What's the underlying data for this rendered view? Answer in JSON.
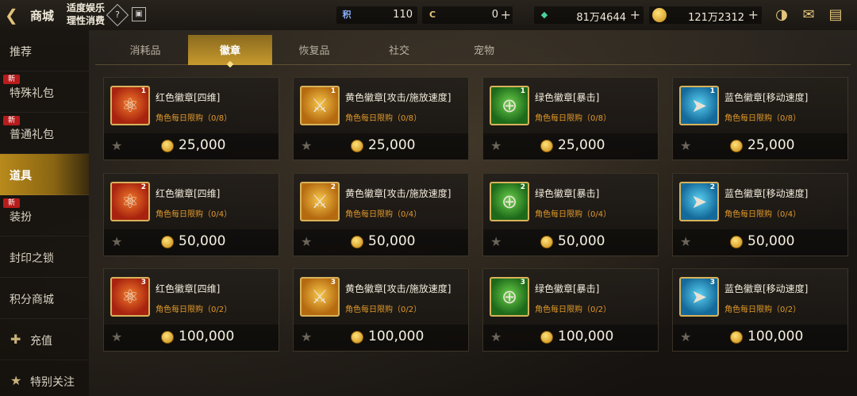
{
  "header": {
    "back_icon": "back-arrow-icon",
    "title": "商城",
    "notice_line1": "适度娱乐",
    "notice_line2": "理性消费",
    "help_label": "?",
    "calendar_label": "📅"
  },
  "currencies": [
    {
      "icon": "积",
      "value": "110",
      "has_plus": false
    },
    {
      "icon": "C",
      "value": "0",
      "has_plus": true
    },
    {
      "icon": "◆",
      "value": "81万4644",
      "has_plus": true
    },
    {
      "icon": "●",
      "value": "121万2312",
      "has_plus": true
    }
  ],
  "top_icons": [
    "pot-icon",
    "mail-icon",
    "chat-icon"
  ],
  "sidebar": {
    "items": [
      {
        "label": "推荐",
        "new": false
      },
      {
        "label": "特殊礼包",
        "new": true
      },
      {
        "label": "普通礼包",
        "new": true
      },
      {
        "label": "道具",
        "new": false,
        "active": true
      },
      {
        "label": "装扮",
        "new": true
      },
      {
        "label": "封印之锁",
        "new": false
      },
      {
        "label": "积分商城",
        "new": false
      },
      {
        "label": "充值",
        "new": false,
        "icon": "recharge-icon"
      },
      {
        "label": "特别关注",
        "new": false,
        "icon": "star-icon"
      }
    ],
    "new_tag": "新"
  },
  "tabs": [
    {
      "label": "消耗品",
      "active": false
    },
    {
      "label": "徽章",
      "active": true
    },
    {
      "label": "恢复品",
      "active": false
    },
    {
      "label": "社交",
      "active": false
    },
    {
      "label": "宠物",
      "active": false
    }
  ],
  "items": [
    {
      "name": "红色徽章[四维]",
      "limit": "角色每日限购（0/8）",
      "price": "25,000",
      "color": "red",
      "level": "1"
    },
    {
      "name": "黄色徽章[攻击/施放速度]",
      "limit": "角色每日限购（0/8）",
      "price": "25,000",
      "color": "yellow",
      "level": "1"
    },
    {
      "name": "绿色徽章[暴击]",
      "limit": "角色每日限购（0/8）",
      "price": "25,000",
      "color": "green",
      "level": "1"
    },
    {
      "name": "蓝色徽章[移动速度]",
      "limit": "角色每日限购（0/8）",
      "price": "25,000",
      "color": "blue",
      "level": "1"
    },
    {
      "name": "红色徽章[四维]",
      "limit": "角色每日限购（0/4）",
      "price": "50,000",
      "color": "red",
      "level": "2"
    },
    {
      "name": "黄色徽章[攻击/施放速度]",
      "limit": "角色每日限购（0/4）",
      "price": "50,000",
      "color": "yellow",
      "level": "2"
    },
    {
      "name": "绿色徽章[暴击]",
      "limit": "角色每日限购（0/4）",
      "price": "50,000",
      "color": "green",
      "level": "2"
    },
    {
      "name": "蓝色徽章[移动速度]",
      "limit": "角色每日限购（0/4）",
      "price": "50,000",
      "color": "blue",
      "level": "2"
    },
    {
      "name": "红色徽章[四维]",
      "limit": "角色每日限购（0/2）",
      "price": "100,000",
      "color": "red",
      "level": "3"
    },
    {
      "name": "黄色徽章[攻击/施放速度]",
      "limit": "角色每日限购（0/2）",
      "price": "100,000",
      "color": "yellow",
      "level": "3"
    },
    {
      "name": "绿色徽章[暴击]",
      "limit": "角色每日限购（0/2）",
      "price": "100,000",
      "color": "green",
      "level": "3"
    },
    {
      "name": "蓝色徽章[移动速度]",
      "limit": "角色每日限购（0/2）",
      "price": "100,000",
      "color": "blue",
      "level": "3"
    }
  ],
  "colors": {
    "accent": "#c79a2e",
    "limit_text": "#e39a2a",
    "new_tag": "#b71c1c"
  }
}
